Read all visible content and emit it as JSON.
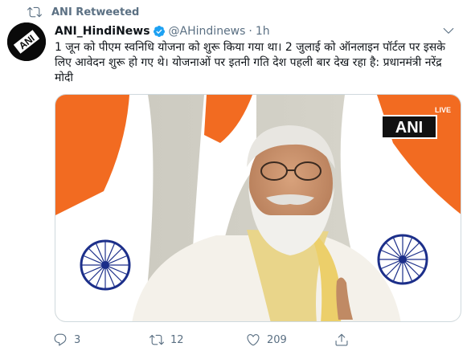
{
  "retweet": {
    "label": "ANI Retweeted"
  },
  "tweet": {
    "display_name": "ANI_HindiNews",
    "handle": "@AHindinews",
    "separator": "·",
    "time": "1h",
    "text": "1 जून को पीएम स्वनिधि योजना को शुरू किया गया था। 2 जुलाई को ऑनलाइन पॉर्टल पर इसके लिए आवेदन शुरू हो गए थे। योजनाओं पर इतनी गति देश पहली बार देख रहा है: प्रधानमंत्री नरेंद्र मोदी"
  },
  "media": {
    "live_badge": "LIVE",
    "watermark": "ANI"
  },
  "avatar": {
    "logo_text": "ANI"
  },
  "actions": {
    "reply_count": "3",
    "retweet_count": "12",
    "like_count": "209"
  },
  "colors": {
    "text": "#0f1419",
    "secondary": "#5b7083",
    "verified": "#1da1f2",
    "saffron": "#f26b21",
    "flag_green": "#2f8f3a",
    "chakra": "#1c2f8a"
  },
  "icons": {
    "retweet_header": "retweet-icon",
    "verified": "verified-badge-icon",
    "more": "chevron-down-icon",
    "reply": "reply-icon",
    "retweet": "retweet-icon",
    "like": "heart-icon",
    "share": "share-icon"
  }
}
